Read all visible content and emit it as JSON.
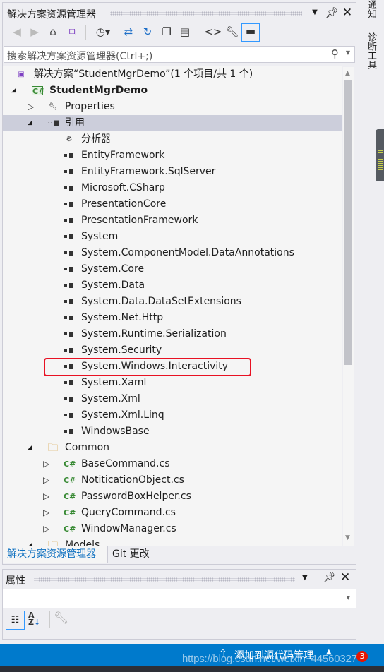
{
  "solution_explorer": {
    "title": "解决方案资源管理器",
    "search_placeholder": "搜索解决方案资源管理器(Ctrl+;)",
    "toolbar": [
      "back-icon",
      "forward-icon",
      "home-icon",
      "switch-views-icon",
      "pending-changes-filter-icon",
      "sync-icon",
      "refresh-icon",
      "collapse-all-icon",
      "show-all-files-icon",
      "view-code-icon",
      "properties-icon",
      "preview-selected-icon"
    ],
    "tree": [
      {
        "label": "解决方案“StudentMgrDemo”(1 个项目/共 1 个)",
        "level": 0,
        "icon": "solution-icon",
        "expander": ""
      },
      {
        "label": "StudentMgrDemo",
        "level": 1,
        "icon": "csharp-project-icon",
        "expander": "expanded",
        "bold": true
      },
      {
        "label": "Properties",
        "level": 2,
        "icon": "wrench-icon",
        "expander": "collapsed"
      },
      {
        "label": "引用",
        "level": 2,
        "icon": "references-icon",
        "expander": "expanded",
        "selected": true
      },
      {
        "label": "分析器",
        "level": 3,
        "icon": "analyzer-icon"
      },
      {
        "label": "EntityFramework",
        "level": 3,
        "icon": "reference-icon"
      },
      {
        "label": "EntityFramework.SqlServer",
        "level": 3,
        "icon": "reference-icon"
      },
      {
        "label": "Microsoft.CSharp",
        "level": 3,
        "icon": "reference-icon"
      },
      {
        "label": "PresentationCore",
        "level": 3,
        "icon": "reference-icon"
      },
      {
        "label": "PresentationFramework",
        "level": 3,
        "icon": "reference-icon"
      },
      {
        "label": "System",
        "level": 3,
        "icon": "reference-icon"
      },
      {
        "label": "System.ComponentModel.DataAnnotations",
        "level": 3,
        "icon": "reference-icon"
      },
      {
        "label": "System.Core",
        "level": 3,
        "icon": "reference-icon"
      },
      {
        "label": "System.Data",
        "level": 3,
        "icon": "reference-icon"
      },
      {
        "label": "System.Data.DataSetExtensions",
        "level": 3,
        "icon": "reference-icon"
      },
      {
        "label": "System.Net.Http",
        "level": 3,
        "icon": "reference-icon"
      },
      {
        "label": "System.Runtime.Serialization",
        "level": 3,
        "icon": "reference-icon"
      },
      {
        "label": "System.Security",
        "level": 3,
        "icon": "reference-icon"
      },
      {
        "label": "System.Windows.Interactivity",
        "level": 3,
        "icon": "reference-icon",
        "highlighted": true
      },
      {
        "label": "System.Xaml",
        "level": 3,
        "icon": "reference-icon"
      },
      {
        "label": "System.Xml",
        "level": 3,
        "icon": "reference-icon"
      },
      {
        "label": "System.Xml.Linq",
        "level": 3,
        "icon": "reference-icon"
      },
      {
        "label": "WindowsBase",
        "level": 3,
        "icon": "reference-icon"
      },
      {
        "label": "Common",
        "level": 2,
        "icon": "folder-icon",
        "expander": "expanded"
      },
      {
        "label": "BaseCommand.cs",
        "level": 3,
        "icon": "csharp-file-icon",
        "expander": "collapsed"
      },
      {
        "label": "NotiticationObject.cs",
        "level": 3,
        "icon": "csharp-file-icon",
        "expander": "collapsed"
      },
      {
        "label": "PasswordBoxHelper.cs",
        "level": 3,
        "icon": "csharp-file-icon",
        "expander": "collapsed"
      },
      {
        "label": "QueryCommand.cs",
        "level": 3,
        "icon": "csharp-file-icon",
        "expander": "collapsed"
      },
      {
        "label": "WindowManager.cs",
        "level": 3,
        "icon": "csharp-file-icon",
        "expander": "collapsed"
      },
      {
        "label": "Models",
        "level": 2,
        "icon": "folder-icon",
        "expander": "expanded"
      }
    ],
    "highlight_color": "#e81123"
  },
  "bottom_tabs": [
    {
      "label": "解决方案资源管理器",
      "active": true
    },
    {
      "label": "Git 更改",
      "active": false
    }
  ],
  "properties": {
    "title": "属性"
  },
  "side_tabs": [
    "通知",
    "诊断工具"
  ],
  "status_bar": {
    "source_control": "添加到源代码管理",
    "notifications": "3",
    "watermark": "https://blog.csdn.net/weixin_44560327"
  },
  "colors": {
    "accent": "#007acc",
    "selection": "#cccedb"
  }
}
